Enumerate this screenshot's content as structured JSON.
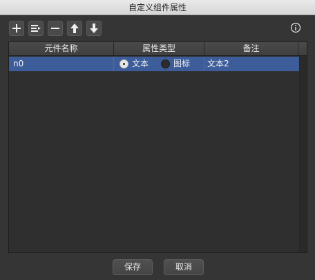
{
  "window": {
    "title": "自定义组件属性"
  },
  "toolbar": {
    "buttons": [
      {
        "name": "add",
        "icon": "plus-icon"
      },
      {
        "name": "insert",
        "icon": "list-insert-icon"
      },
      {
        "name": "remove",
        "icon": "minus-icon"
      },
      {
        "name": "move-up",
        "icon": "arrow-up-icon"
      },
      {
        "name": "move-down",
        "icon": "arrow-down-icon"
      }
    ],
    "info_icon": "info-icon"
  },
  "table": {
    "columns": [
      "元件名称",
      "属性类型",
      "备注"
    ],
    "rows": [
      {
        "name": "n0",
        "type_options": [
          {
            "label": "文本",
            "selected": true
          },
          {
            "label": "图标",
            "selected": false
          }
        ],
        "note": "文本2"
      }
    ]
  },
  "footer": {
    "save_label": "保存",
    "cancel_label": "取消"
  },
  "colors": {
    "selected_row": "#3d5d9a",
    "background": "#353535",
    "titlebar": "#e0e0e0"
  }
}
